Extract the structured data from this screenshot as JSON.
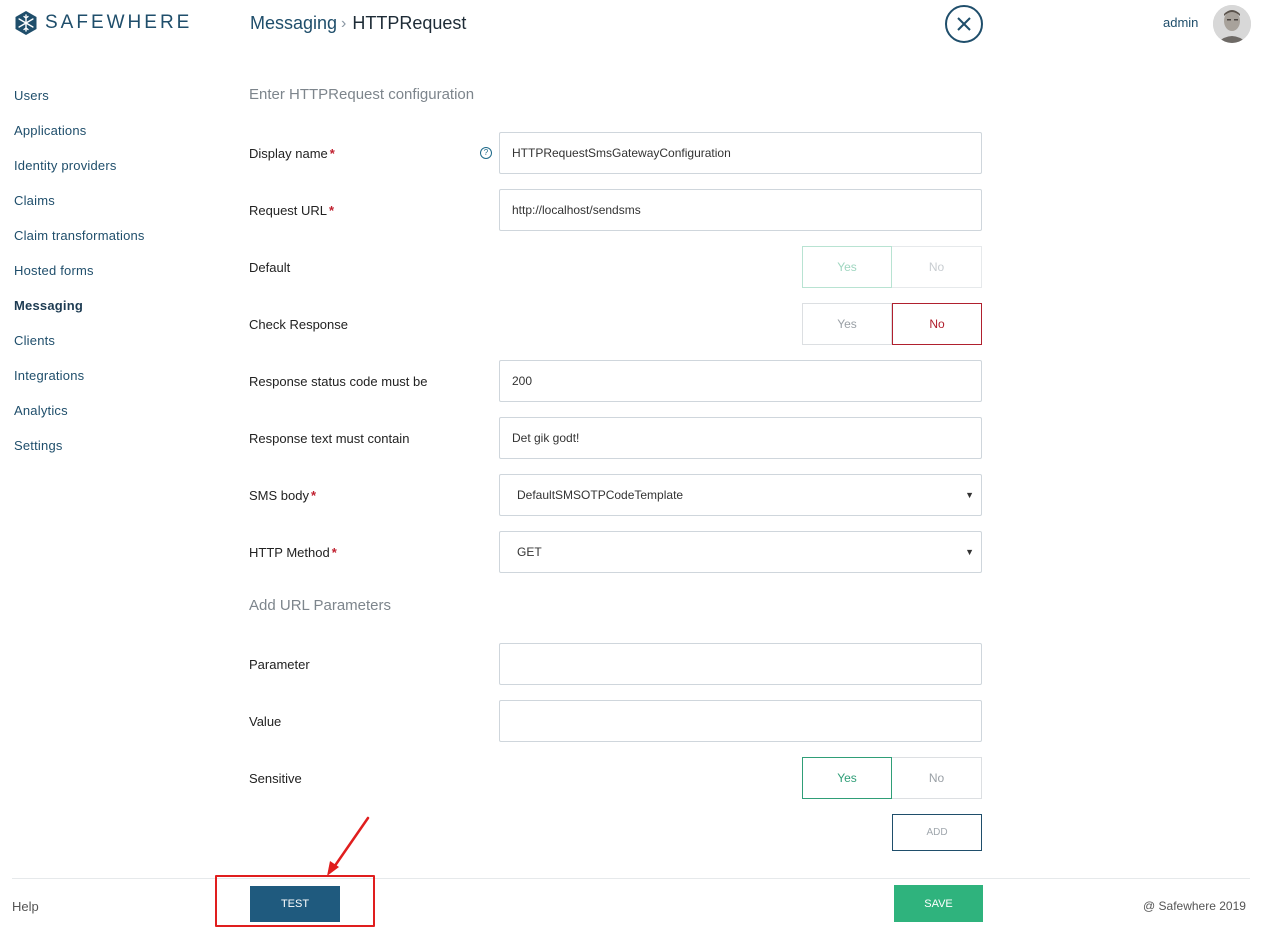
{
  "app": {
    "brand": "SAFEWHERE"
  },
  "header": {
    "breadcrumb_parent": "Messaging",
    "breadcrumb_sep": "›",
    "breadcrumb_current": "HTTPRequest",
    "user": "admin"
  },
  "sidebar": {
    "items": [
      {
        "label": "Users"
      },
      {
        "label": "Applications"
      },
      {
        "label": "Identity providers"
      },
      {
        "label": "Claims"
      },
      {
        "label": "Claim transformations"
      },
      {
        "label": "Hosted forms"
      },
      {
        "label": "Messaging",
        "active": true
      },
      {
        "label": "Clients"
      },
      {
        "label": "Integrations"
      },
      {
        "label": "Analytics"
      },
      {
        "label": "Settings"
      }
    ]
  },
  "form": {
    "section_title": "Enter HTTPRequest configuration",
    "display_name": {
      "label": "Display name",
      "required": "*",
      "value": "HTTPRequestSmsGatewayConfiguration",
      "help": "?"
    },
    "request_url": {
      "label": "Request URL",
      "required": "*",
      "value": "http://localhost/sendsms"
    },
    "default": {
      "label": "Default",
      "yes": "Yes",
      "no": "No",
      "selected": "Yes",
      "disabled": true
    },
    "check_response": {
      "label": "Check Response",
      "yes": "Yes",
      "no": "No",
      "selected": "No"
    },
    "status_code": {
      "label": "Response status code must be",
      "value": "200"
    },
    "response_text": {
      "label": "Response text must contain",
      "value": "Det gik godt!"
    },
    "sms_body": {
      "label": "SMS body",
      "required": "*",
      "value": "DefaultSMSOTPCodeTemplate",
      "caret": "▼"
    },
    "http_method": {
      "label": "HTTP Method",
      "required": "*",
      "value": "GET",
      "caret": "▼"
    },
    "url_params_title": "Add URL Parameters",
    "parameter": {
      "label": "Parameter",
      "value": ""
    },
    "value": {
      "label": "Value",
      "value": ""
    },
    "sensitive": {
      "label": "Sensitive",
      "yes": "Yes",
      "no": "No",
      "selected": "Yes"
    },
    "add_label": "ADD"
  },
  "footer": {
    "help": "Help",
    "test_label": "TEST",
    "save_label": "SAVE",
    "copyright": "@ Safewhere 2019"
  },
  "colors": {
    "brand": "#1f4e6b",
    "save": "#2fb37d",
    "test": "#1f5a7e",
    "required": "#c0202f",
    "annotation": "#e01e1e"
  }
}
